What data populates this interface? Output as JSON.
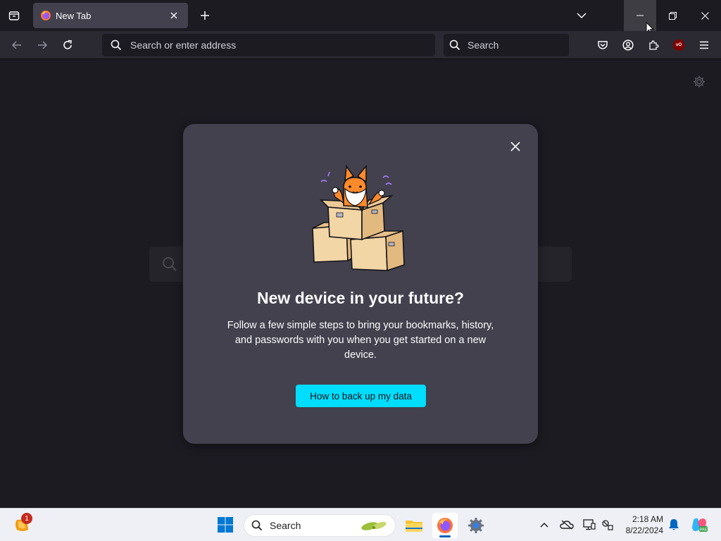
{
  "browser": {
    "tab": {
      "title": "New Tab"
    },
    "urlbar": {
      "placeholder": "Search or enter address"
    },
    "searchbar": {
      "placeholder": "Search"
    }
  },
  "modal": {
    "title": "New device in your future?",
    "body": "Follow a few simple steps to bring your bookmarks, history, and passwords with you when you get started on a new device.",
    "cta_label": "How to back up my data"
  },
  "taskbar": {
    "search_placeholder": "Search",
    "weather_badge": "1",
    "time": "2:18 AM",
    "date": "8/22/2024"
  },
  "colors": {
    "accent_button": "#00ddff",
    "modal_background": "#42414d",
    "page_background": "#1c1b22"
  },
  "icons": {
    "tabstrip": [
      "tab-list-icon",
      "firefox-favicon",
      "close-icon",
      "plus-icon",
      "chevron-down-icon",
      "minimize-icon",
      "restore-icon",
      "close-icon"
    ],
    "navbar": [
      "back-arrow-icon",
      "forward-arrow-icon",
      "reload-icon",
      "search-icon",
      "pocket-icon",
      "account-icon",
      "extensions-icon",
      "ublock-icon",
      "hamburger-menu-icon"
    ],
    "taskbar": [
      "weather-icon",
      "windows-start-icon",
      "search-icon",
      "file-explorer-icon",
      "firefox-icon",
      "settings-icon",
      "chevron-up-icon",
      "onedrive-icon",
      "display-icon",
      "network-icon",
      "notification-bell-icon",
      "copilot-icon"
    ]
  }
}
